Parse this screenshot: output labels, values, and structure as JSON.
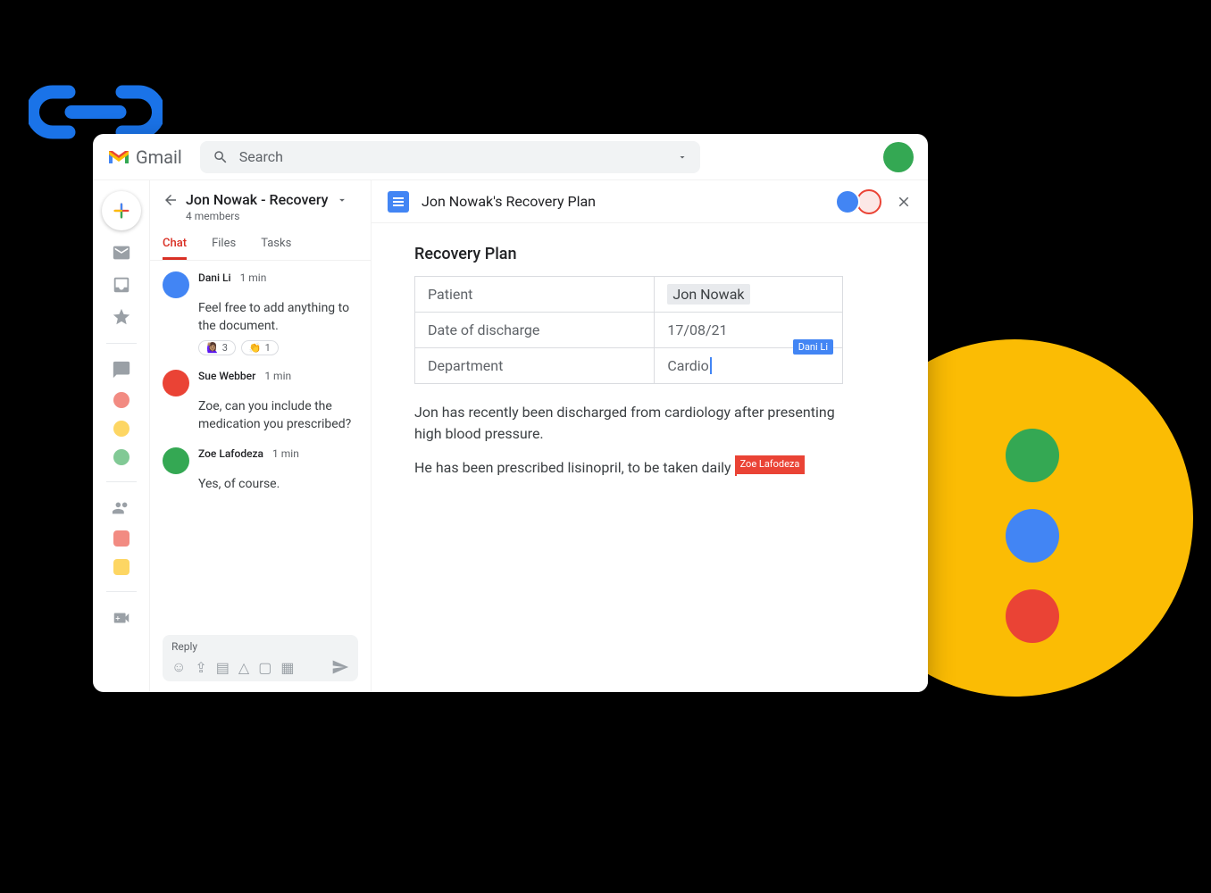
{
  "brand": {
    "name": "Gmail"
  },
  "search": {
    "placeholder": "Search"
  },
  "space": {
    "name": "Jon Nowak - Recovery",
    "members": "4 members",
    "tabs": {
      "chat": "Chat",
      "files": "Files",
      "tasks": "Tasks"
    }
  },
  "messages": [
    {
      "author": "Dani Li",
      "time": "1 min",
      "body": "Feel free to add anything to the document.",
      "avatar": "blue",
      "reactions": [
        {
          "emoji": "🙋🏽‍♀️",
          "count": "3"
        },
        {
          "emoji": "👏",
          "count": "1"
        }
      ]
    },
    {
      "author": "Sue Webber",
      "time": "1 min",
      "body": "Zoe, can you include the medication you prescribed?",
      "avatar": "red"
    },
    {
      "author": "Zoe Lafodeza",
      "time": "1 min",
      "body": "Yes, of course.",
      "avatar": "green"
    }
  ],
  "reply": {
    "label": "Reply"
  },
  "doc": {
    "title": "Jon Nowak's Recovery Plan",
    "heading": "Recovery Plan",
    "table": {
      "patient_label": "Patient",
      "patient_value": "Jon Nowak",
      "discharge_label": "Date of discharge",
      "discharge_value": "17/08/21",
      "dept_label": "Department",
      "dept_value": "Cardio"
    },
    "collab_cursor1": "Dani Li",
    "para1": "Jon has recently been discharged from cardiology after presenting high blood pressure.",
    "para2a": "He has been prescribed lisinopril, to be taken daily",
    "collab_cursor2": "Zoe Lafodeza"
  }
}
